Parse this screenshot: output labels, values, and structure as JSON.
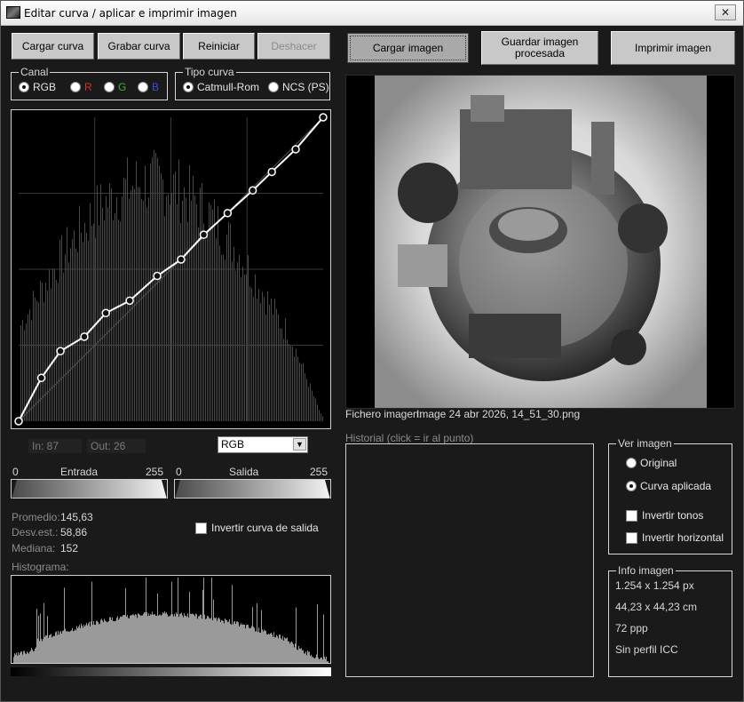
{
  "window": {
    "title": "Editar curva / aplicar e imprimir imagen",
    "close_label": "✕"
  },
  "toolbar_left": {
    "load_curve": "Cargar curva",
    "save_curve": "Grabar curva",
    "reset": "Reiniciar",
    "undo": "Deshacer"
  },
  "toolbar_right": {
    "load_image": "Cargar imagen",
    "save_processed": "Guardar imagen procesada",
    "print_image": "Imprimir imagen"
  },
  "channel": {
    "legend": "Canal",
    "options": [
      {
        "label": "RGB",
        "selected": true,
        "color": "#e6e6e6"
      },
      {
        "label": "R",
        "selected": false,
        "color": "#d0342c"
      },
      {
        "label": "G",
        "selected": false,
        "color": "#3cb043"
      },
      {
        "label": "B",
        "selected": false,
        "color": "#3a4fd8"
      }
    ]
  },
  "curve_type": {
    "legend": "Tipo curva",
    "options": [
      {
        "label": "Catmull-Rom",
        "selected": true
      },
      {
        "label": "NCS (PS)",
        "selected": false
      }
    ]
  },
  "curve": {
    "control_points": [
      [
        0,
        0
      ],
      [
        19,
        42
      ],
      [
        35,
        68
      ],
      [
        55,
        82
      ],
      [
        73,
        105
      ],
      [
        93,
        117
      ],
      [
        116,
        141
      ],
      [
        136,
        157
      ],
      [
        155,
        181
      ],
      [
        175,
        202
      ],
      [
        196,
        224
      ],
      [
        212,
        242
      ],
      [
        232,
        264
      ],
      [
        255,
        295
      ]
    ]
  },
  "io_readout": {
    "in": "In: 87",
    "out": "Out: 26"
  },
  "channel_select": {
    "value": "RGB"
  },
  "input_range": {
    "min": "0",
    "label": "Entrada",
    "max": "255"
  },
  "output_range": {
    "min": "0",
    "label": "Salida",
    "max": "255"
  },
  "stats": {
    "mean_label": "Promedio:",
    "mean_value": "145,63",
    "std_label": "Desv.est.:",
    "std_value": "58,86",
    "median_label": "Mediana:",
    "median_value": "152"
  },
  "invert_output": {
    "label": "Invertir curva de salida",
    "checked": false
  },
  "histogram": {
    "label": "Histograma:"
  },
  "file": {
    "label": "Fichero imagen:",
    "name": "Image 24 abr 2026, 14_51_30.png"
  },
  "history": {
    "label": "Historial  (click = ir al punto)"
  },
  "view_image": {
    "legend": "Ver imagen",
    "original": "Original",
    "applied": "Curva aplicada",
    "selected": "applied",
    "invert_tones": "Invertir tonos",
    "invert_horizontal": "Invertir horizontal"
  },
  "info": {
    "legend": "Info imagen",
    "pixels": "1.254 x 1.254 px",
    "cm": "44,23 x 44,23 cm",
    "ppp": "72 ppp",
    "icc": "Sin perfil ICC"
  },
  "colors": {
    "background": "#1a1a1a",
    "button": "#c8c8c8",
    "histogram_bars": "#9a9a9a",
    "curve": "#ffffff"
  }
}
